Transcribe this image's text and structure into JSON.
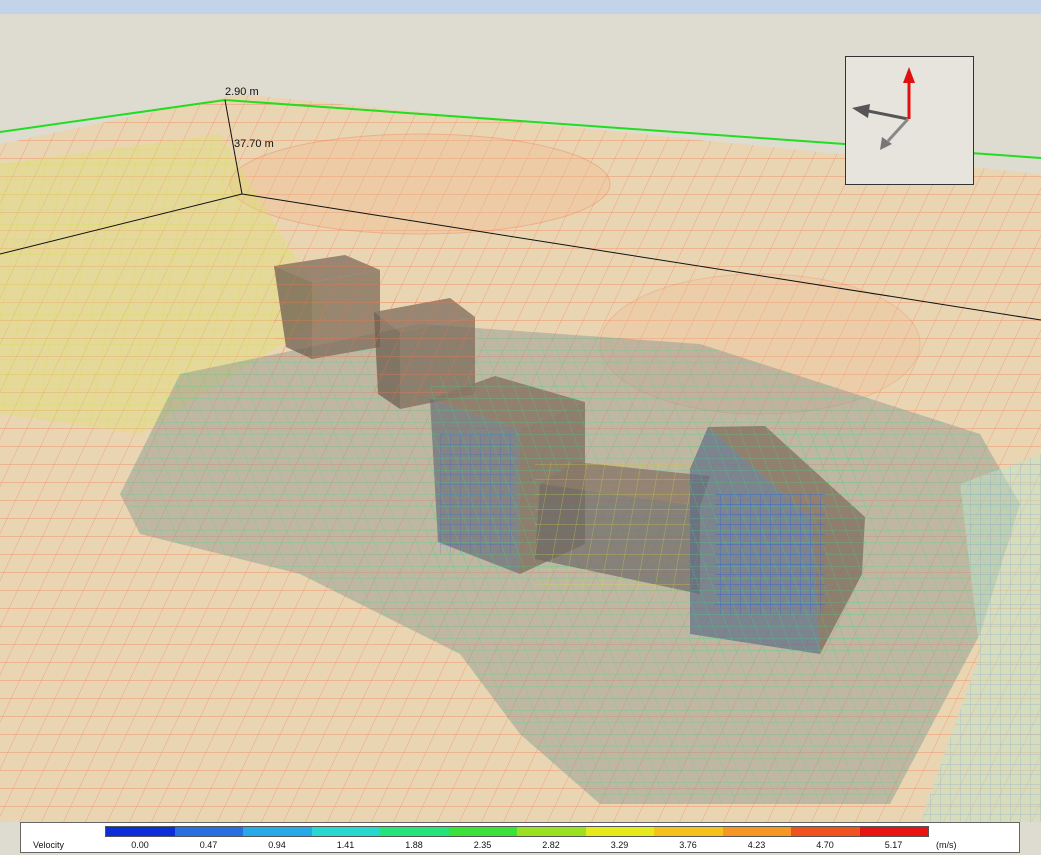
{
  "dimensions": {
    "height_label": "2.90 m",
    "depth_label": "37.70 m"
  },
  "gizmo": {
    "up_axis_icon": "red-arrow-up",
    "x_axis_icon": "grey-arrow-left",
    "y_axis_icon": "grey-arrow-down"
  },
  "legend": {
    "title": "Velocity",
    "unit": "(m/s)",
    "ticks": [
      "0.00",
      "0.47",
      "0.94",
      "1.41",
      "1.88",
      "2.35",
      "2.82",
      "3.29",
      "3.76",
      "4.23",
      "4.70",
      "5.17"
    ],
    "colors": [
      "#0a2fd6",
      "#2a6fe0",
      "#25a9e8",
      "#27d8cf",
      "#26e37a",
      "#3be23a",
      "#9ae21f",
      "#e6ea1c",
      "#f5c21c",
      "#f59722",
      "#f0531f",
      "#e81414"
    ]
  },
  "colors": {
    "ground": "#dedbd0",
    "domain_outline": "#22dd22",
    "building": "#7b6a5a"
  }
}
